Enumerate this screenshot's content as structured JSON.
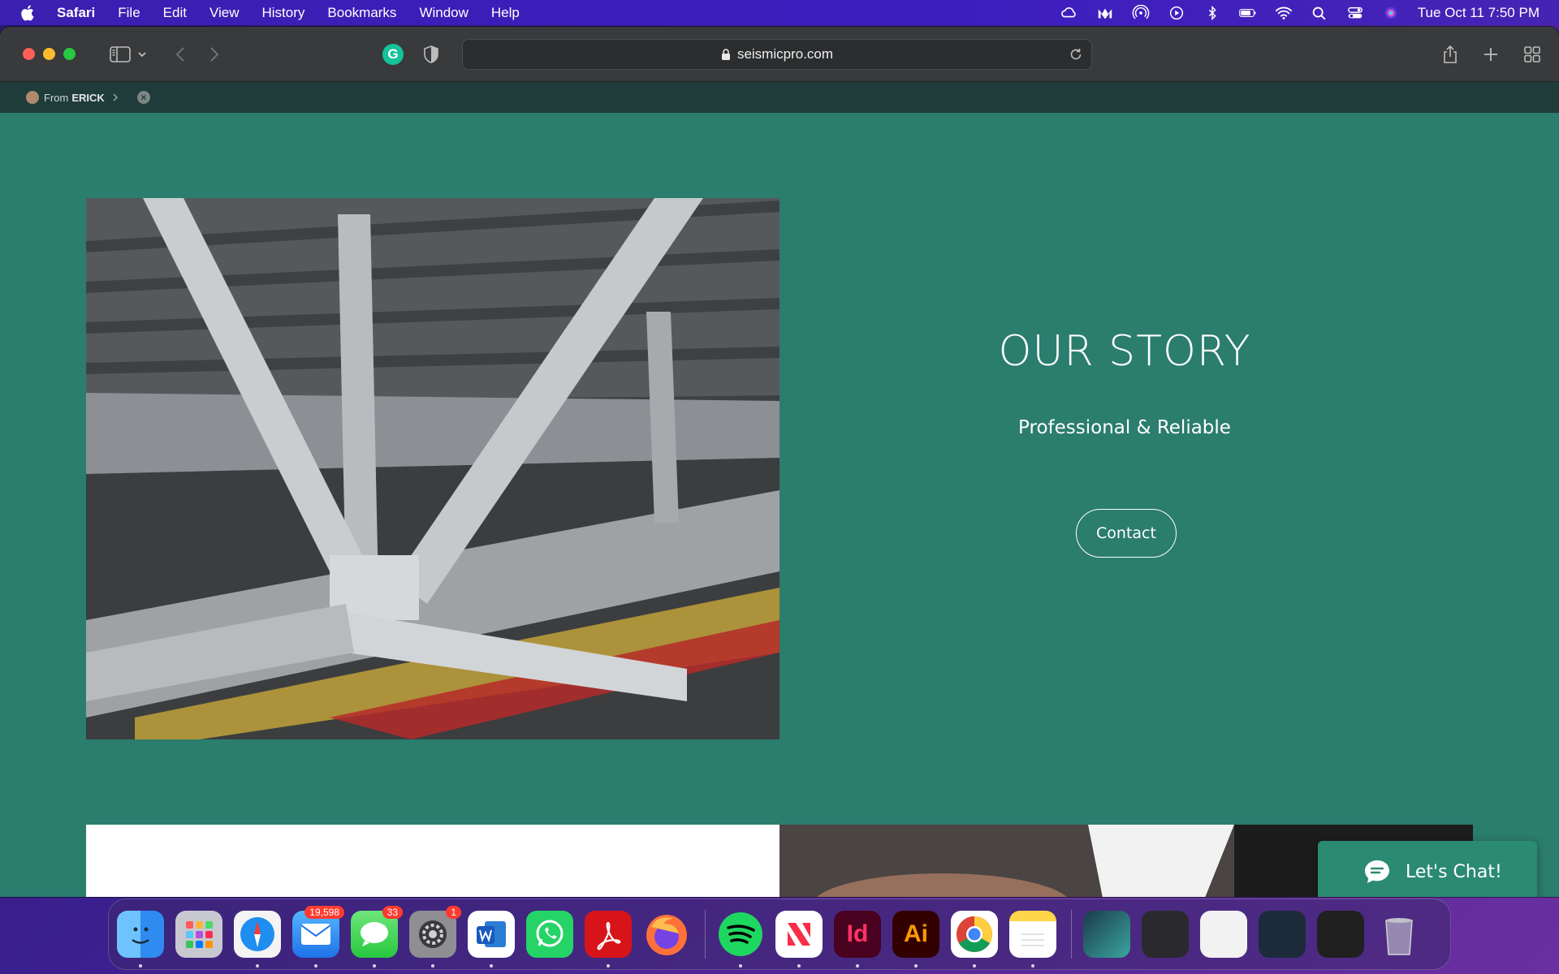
{
  "menubar": {
    "app_name": "Safari",
    "items": [
      "File",
      "Edit",
      "View",
      "History",
      "Bookmarks",
      "Window",
      "Help"
    ],
    "clock": "Tue Oct 11  7:50 PM"
  },
  "browser": {
    "url": "seismicpro.com",
    "favorites_bar": {
      "from_label": "From",
      "from_name": "ERICK"
    }
  },
  "page": {
    "title": "OUR STORY",
    "subtitle": "Professional & Reliable",
    "contact_label": "Contact",
    "chat_label": "Let's Chat!"
  },
  "dock": {
    "mail_badge": "19,598",
    "messages_badge": "33",
    "settings_badge": "1",
    "indesign_label": "Id",
    "illustrator_label": "Ai"
  }
}
